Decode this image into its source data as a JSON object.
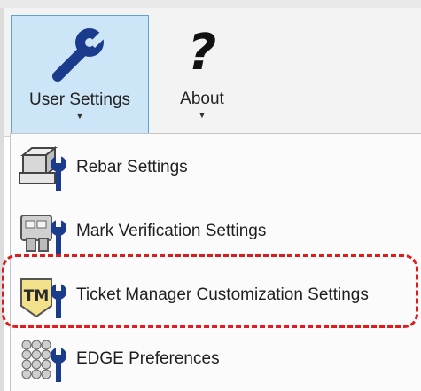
{
  "ribbon": {
    "user_settings": {
      "label": "User Settings",
      "icon": "wrench-icon"
    },
    "about": {
      "label": "About",
      "icon": "question-mark-icon",
      "glyph": "?"
    }
  },
  "menu": {
    "items": [
      {
        "label": "Rebar Settings",
        "icon": "rebar-settings-icon"
      },
      {
        "label": "Mark Verification Settings",
        "icon": "mark-verification-icon"
      },
      {
        "label": "Ticket Manager Customization Settings",
        "icon": "ticket-manager-icon",
        "badge": "TM",
        "highlighted": true
      },
      {
        "label": "EDGE Preferences",
        "icon": "edge-preferences-icon"
      }
    ]
  },
  "colors": {
    "active_button_bg": "#cde6f7",
    "active_button_border": "#5fa3d8",
    "wrench_blue": "#1b3c8c",
    "highlight": "#e01b1b"
  }
}
